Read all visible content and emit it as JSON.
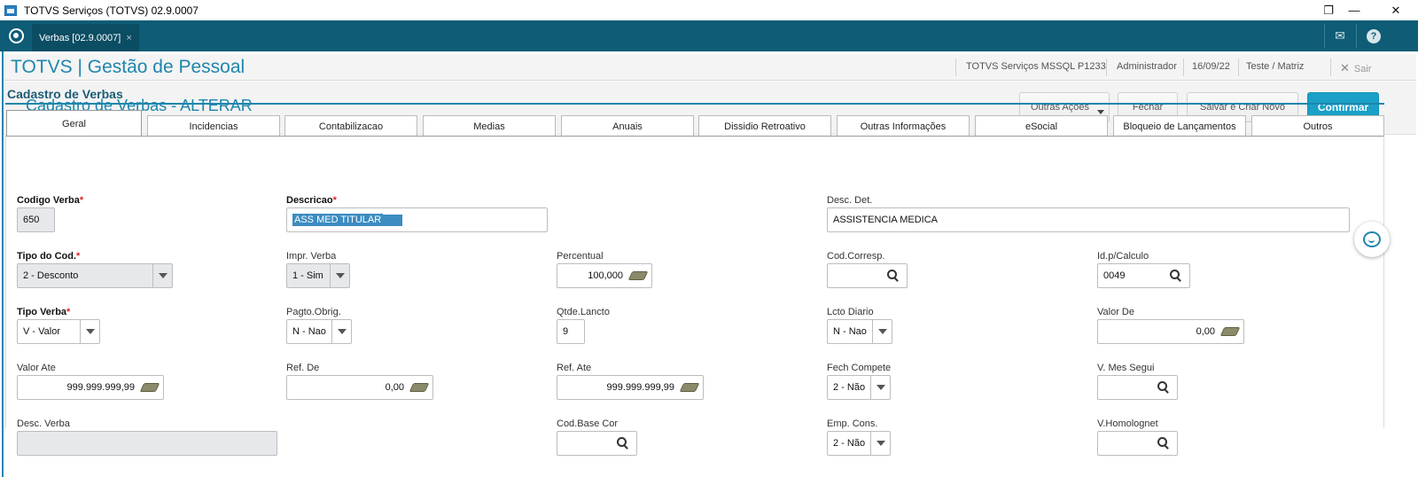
{
  "window": {
    "title": "TOTVS Serviços (TOTVS) 02.9.0007",
    "minimize": "—",
    "restore": "❐",
    "close": "✕"
  },
  "tabbar": {
    "tab_label": "Verbas [02.9.0007]",
    "tab_close": "×",
    "mail_icon": "✉",
    "help_icon": "?"
  },
  "header": {
    "brand": "TOTVS | Gestão de Pessoal",
    "environment": "TOTVS Serviços MSSQL P1233",
    "user": "Administrador",
    "date": "16/09/22",
    "company": "Teste / Matriz",
    "exit": "Sair",
    "exit_icon": "✕"
  },
  "page": {
    "title": "Cadastro de Verbas - ALTERAR",
    "section": "Cadastro de Verbas"
  },
  "actions": {
    "other": "Outras Ações",
    "close": "Fechar",
    "save_new": "Salvar e Criar Novo",
    "confirm": "Confirmar"
  },
  "tabs": [
    "Geral",
    "Incidencias",
    "Contabilizacao",
    "Medias",
    "Anuais",
    "Dissidio Retroativo",
    "Outras Informações",
    "eSocial",
    "Bloqueio de Lançamentos",
    "Outros"
  ],
  "fields": {
    "codigo_verba": {
      "label": "Codigo Verba",
      "value": "650"
    },
    "descricao": {
      "label": "Descricao",
      "value": "ASS MED TITULAR"
    },
    "desc_det": {
      "label": "Desc. Det.",
      "value": "ASSISTENCIA MEDICA"
    },
    "tipo_cod": {
      "label": "Tipo do Cod.",
      "value": "2 - Desconto"
    },
    "impr_verba": {
      "label": "Impr. Verba",
      "value": "1 - Sim"
    },
    "percentual": {
      "label": "Percentual",
      "value": "100,000"
    },
    "cod_corresp": {
      "label": "Cod.Corresp.",
      "value": ""
    },
    "id_calculo": {
      "label": "Id.p/Calculo",
      "value": "0049"
    },
    "tipo_verba": {
      "label": "Tipo Verba",
      "value": "V - Valor"
    },
    "pagto_obrig": {
      "label": "Pagto.Obrig.",
      "value": "N - Nao"
    },
    "qtde_lancto": {
      "label": "Qtde.Lancto",
      "value": "9"
    },
    "lcto_diario": {
      "label": "Lcto Diario",
      "value": "N - Nao"
    },
    "valor_de": {
      "label": "Valor De",
      "value": "0,00"
    },
    "valor_ate": {
      "label": "Valor Ate",
      "value": "999.999.999,99"
    },
    "ref_de": {
      "label": "Ref. De",
      "value": "0,00"
    },
    "ref_ate": {
      "label": "Ref. Ate",
      "value": "999.999.999,99"
    },
    "fech_compete": {
      "label": "Fech Compete",
      "value": "2 - Não"
    },
    "v_mes_segui": {
      "label": "V. Mes Segui",
      "value": ""
    },
    "desc_verba": {
      "label": "Desc. Verba",
      "value": ""
    },
    "cod_base_cor": {
      "label": "Cod.Base Cor",
      "value": ""
    },
    "emp_cons": {
      "label": "Emp. Cons.",
      "value": "2 - Não"
    },
    "v_homolognet": {
      "label": "V.Homolognet",
      "value": ""
    }
  },
  "required_mark": "*",
  "colors": {
    "accent": "#1e86ad",
    "tabbar": "#0e5c76",
    "primary_button": "#1ba0c8",
    "required": "#dd2222"
  }
}
